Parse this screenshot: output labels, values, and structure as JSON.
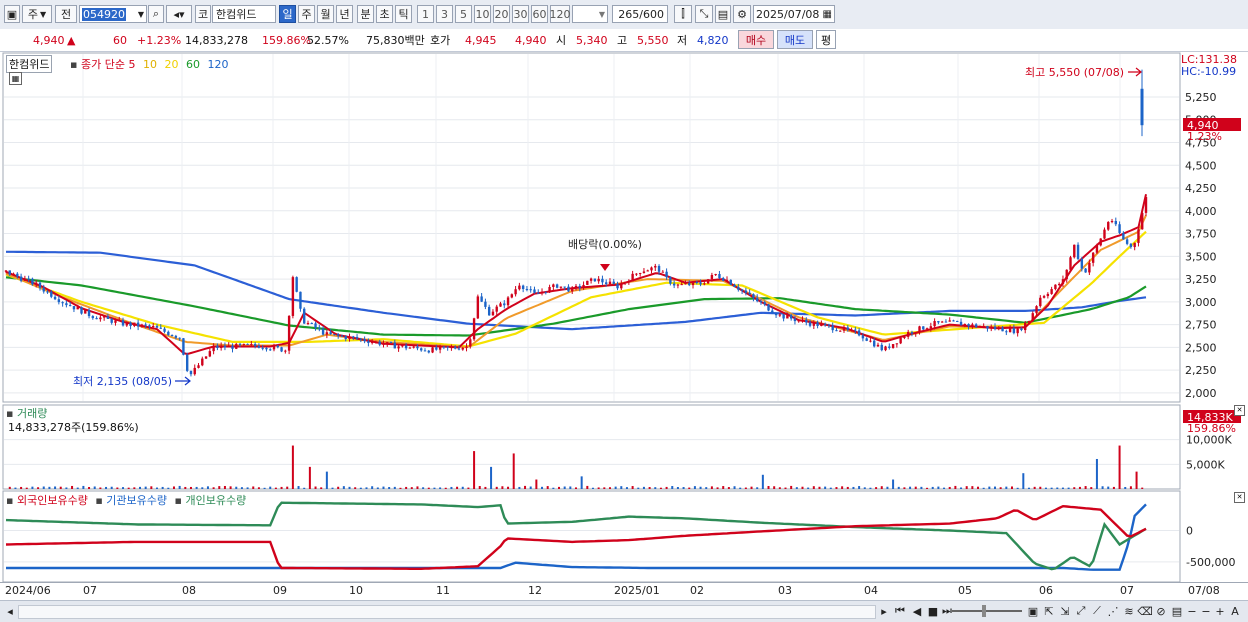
{
  "toolbar": {
    "kind_label": "주",
    "prev_label": "전",
    "code_value": "054920",
    "stock_prefix": "코",
    "stock_name": "한컴위드",
    "periods": [
      "일",
      "주",
      "월",
      "년",
      "분",
      "초",
      "틱"
    ],
    "active_period": "일",
    "intervals": [
      "1",
      "3",
      "5",
      "10",
      "20",
      "30",
      "60",
      "120"
    ],
    "count_value": "265",
    "count_total": "/600",
    "date_value": "2025/07/08"
  },
  "quote": {
    "price": "4,940",
    "change_arrow": "▲",
    "change": "60",
    "change_pct": "+1.23%",
    "volume": "14,833,278",
    "volume_ratio": "159.86%",
    "turnover_rate": "52.57%",
    "amount": "75,830백만",
    "bid_label": "호가",
    "ask_price": "4,945",
    "bid_price": "4,940",
    "open_label": "시",
    "open": "5,340",
    "high_label": "고",
    "high": "5,550",
    "low_label": "저",
    "low": "4,820",
    "buy_label": "매수",
    "sell_label": "매도",
    "avg_label": "평"
  },
  "price_panel": {
    "name_tag": "한컴위드",
    "legend_title": "종가 단순",
    "ma_labels": [
      "5",
      "10",
      "20",
      "60",
      "120"
    ],
    "ma_colors": [
      "#d0021b",
      "#e0b000",
      "#f5d800",
      "#1a9a2a",
      "#1c64c8"
    ],
    "lc_label": "LC:131.38",
    "hc_label": "HC:-10.99",
    "high_annot": "최고 5,550 (07/08)",
    "low_annot": "최저 2,135 (08/05)",
    "dividend_annot": "배당락(0.00%)",
    "current_tag": "4,940",
    "current_pct": "1.23%"
  },
  "volume_panel": {
    "title": "거래량",
    "value_text": "14,833,278주(159.86%)",
    "current_tag": "14,833K",
    "current_pct": "159.86%"
  },
  "holdings_panel": {
    "foreign_label": "외국인보유수량",
    "inst_label": "기관보유수량",
    "indiv_label": "개인보유수량",
    "foreign_color": "#d0021b",
    "inst_color": "#1c64c8",
    "indiv_color": "#2e8b57"
  },
  "x_axis": {
    "labels": [
      "2024/06",
      "07",
      "08",
      "09",
      "10",
      "11",
      "12",
      "2025/01",
      "02",
      "03",
      "04",
      "05",
      "06",
      "07"
    ],
    "end_label": "07/08"
  },
  "chart_data": {
    "type": "candlestick",
    "price_axis": {
      "ticks": [
        2000,
        2250,
        2500,
        2750,
        3000,
        3250,
        3500,
        3750,
        4000,
        4250,
        4500,
        4750,
        5000,
        5250
      ],
      "range": [
        1900,
        5700
      ]
    },
    "volume_axis": {
      "ticks": [
        "5,000K",
        "10,000K"
      ],
      "range": [
        0,
        16000000
      ]
    },
    "holdings_axis": {
      "ticks": [
        "0",
        "-500,000"
      ]
    },
    "price_path": [
      [
        0,
        3330
      ],
      [
        15,
        3200
      ],
      [
        30,
        3000
      ],
      [
        45,
        2850
      ],
      [
        62,
        2760
      ],
      [
        78,
        2720
      ],
      [
        92,
        2610
      ],
      [
        97,
        2180
      ],
      [
        110,
        2500
      ],
      [
        135,
        2520
      ],
      [
        148,
        2470
      ],
      [
        152,
        3280
      ],
      [
        157,
        2800
      ],
      [
        170,
        2640
      ],
      [
        185,
        2600
      ],
      [
        205,
        2520
      ],
      [
        225,
        2470
      ],
      [
        245,
        2510
      ],
      [
        250,
        3050
      ],
      [
        256,
        2880
      ],
      [
        265,
        3000
      ],
      [
        272,
        3200
      ],
      [
        280,
        3080
      ],
      [
        292,
        3180
      ],
      [
        300,
        3130
      ],
      [
        312,
        3250
      ],
      [
        324,
        3170
      ],
      [
        336,
        3340
      ],
      [
        345,
        3380
      ],
      [
        350,
        3250
      ],
      [
        355,
        3180
      ],
      [
        368,
        3200
      ],
      [
        376,
        3300
      ],
      [
        382,
        3240
      ],
      [
        395,
        3050
      ],
      [
        410,
        2850
      ],
      [
        425,
        2770
      ],
      [
        440,
        2710
      ],
      [
        452,
        2650
      ],
      [
        465,
        2470
      ],
      [
        478,
        2660
      ],
      [
        492,
        2760
      ],
      [
        502,
        2770
      ],
      [
        512,
        2740
      ],
      [
        524,
        2710
      ],
      [
        536,
        2680
      ],
      [
        542,
        2800
      ],
      [
        548,
        3050
      ],
      [
        560,
        3230
      ],
      [
        566,
        3620
      ],
      [
        571,
        3300
      ],
      [
        580,
        3700
      ],
      [
        585,
        3930
      ],
      [
        592,
        3680
      ],
      [
        597,
        3580
      ],
      [
        604,
        4140
      ]
    ],
    "ma_paths": {
      "ma5": [
        [
          0,
          3330
        ],
        [
          20,
          3160
        ],
        [
          40,
          2930
        ],
        [
          62,
          2780
        ],
        [
          80,
          2700
        ],
        [
          95,
          2420
        ],
        [
          110,
          2510
        ],
        [
          140,
          2510
        ],
        [
          150,
          2550
        ],
        [
          158,
          2880
        ],
        [
          175,
          2640
        ],
        [
          200,
          2540
        ],
        [
          240,
          2500
        ],
        [
          250,
          2700
        ],
        [
          265,
          2920
        ],
        [
          280,
          3090
        ],
        [
          300,
          3150
        ],
        [
          325,
          3190
        ],
        [
          345,
          3320
        ],
        [
          360,
          3210
        ],
        [
          380,
          3250
        ],
        [
          400,
          3000
        ],
        [
          420,
          2800
        ],
        [
          445,
          2710
        ],
        [
          465,
          2560
        ],
        [
          480,
          2650
        ],
        [
          500,
          2750
        ],
        [
          525,
          2710
        ],
        [
          540,
          2720
        ],
        [
          552,
          2960
        ],
        [
          566,
          3400
        ],
        [
          580,
          3660
        ],
        [
          590,
          3730
        ],
        [
          600,
          3820
        ],
        [
          604,
          4180
        ]
      ],
      "ma10": [
        [
          0,
          3310
        ],
        [
          30,
          3050
        ],
        [
          62,
          2800
        ],
        [
          95,
          2560
        ],
        [
          120,
          2520
        ],
        [
          150,
          2520
        ],
        [
          170,
          2640
        ],
        [
          200,
          2560
        ],
        [
          245,
          2500
        ],
        [
          265,
          2820
        ],
        [
          300,
          3120
        ],
        [
          340,
          3250
        ],
        [
          380,
          3230
        ],
        [
          420,
          2830
        ],
        [
          465,
          2580
        ],
        [
          500,
          2730
        ],
        [
          540,
          2720
        ],
        [
          560,
          3150
        ],
        [
          580,
          3570
        ],
        [
          600,
          3770
        ],
        [
          604,
          3950
        ]
      ],
      "ma20": [
        [
          0,
          3300
        ],
        [
          40,
          3000
        ],
        [
          80,
          2750
        ],
        [
          120,
          2560
        ],
        [
          160,
          2560
        ],
        [
          200,
          2590
        ],
        [
          245,
          2510
        ],
        [
          270,
          2650
        ],
        [
          310,
          3050
        ],
        [
          350,
          3210
        ],
        [
          390,
          3180
        ],
        [
          430,
          2830
        ],
        [
          465,
          2640
        ],
        [
          510,
          2710
        ],
        [
          550,
          2770
        ],
        [
          575,
          3200
        ],
        [
          590,
          3500
        ],
        [
          604,
          3770
        ]
      ],
      "ma60": [
        [
          0,
          3270
        ],
        [
          40,
          3180
        ],
        [
          100,
          2950
        ],
        [
          150,
          2740
        ],
        [
          200,
          2640
        ],
        [
          245,
          2630
        ],
        [
          290,
          2760
        ],
        [
          330,
          2920
        ],
        [
          370,
          3030
        ],
        [
          410,
          3040
        ],
        [
          450,
          2920
        ],
        [
          500,
          2860
        ],
        [
          540,
          2770
        ],
        [
          575,
          2920
        ],
        [
          595,
          3050
        ],
        [
          604,
          3170
        ]
      ],
      "ma120": [
        [
          0,
          3550
        ],
        [
          50,
          3540
        ],
        [
          100,
          3400
        ],
        [
          150,
          3030
        ],
        [
          200,
          2880
        ],
        [
          245,
          2760
        ],
        [
          300,
          2700
        ],
        [
          360,
          2780
        ],
        [
          400,
          2880
        ],
        [
          450,
          2850
        ],
        [
          500,
          2900
        ],
        [
          540,
          2900
        ],
        [
          570,
          2940
        ],
        [
          590,
          3010
        ],
        [
          604,
          3050
        ]
      ]
    },
    "holdings_series": {
      "indiv": [
        [
          0,
          0.3
        ],
        [
          70,
          0.35
        ],
        [
          140,
          0.36
        ],
        [
          145,
          0.1
        ],
        [
          220,
          0.12
        ],
        [
          250,
          0.15
        ],
        [
          262,
          0.13
        ],
        [
          265,
          0.34
        ],
        [
          300,
          0.32
        ],
        [
          310,
          0.3
        ],
        [
          330,
          0.26
        ],
        [
          360,
          0.28
        ],
        [
          400,
          0.33
        ],
        [
          450,
          0.38
        ],
        [
          500,
          0.42
        ],
        [
          530,
          0.45
        ],
        [
          545,
          0.8
        ],
        [
          555,
          0.87
        ],
        [
          565,
          0.72
        ],
        [
          575,
          0.84
        ],
        [
          582,
          0.35
        ],
        [
          590,
          0.58
        ],
        [
          604,
          0.4
        ]
      ],
      "foreign": [
        [
          0,
          0.58
        ],
        [
          70,
          0.55
        ],
        [
          140,
          0.55
        ],
        [
          145,
          0.85
        ],
        [
          220,
          0.86
        ],
        [
          250,
          0.83
        ],
        [
          262,
          0.6
        ],
        [
          265,
          0.51
        ],
        [
          300,
          0.55
        ],
        [
          330,
          0.53
        ],
        [
          360,
          0.48
        ],
        [
          400,
          0.43
        ],
        [
          450,
          0.37
        ],
        [
          500,
          0.34
        ],
        [
          525,
          0.28
        ],
        [
          535,
          0.18
        ],
        [
          545,
          0.3
        ],
        [
          560,
          0.14
        ],
        [
          580,
          0.18
        ],
        [
          595,
          0.5
        ],
        [
          604,
          0.4
        ]
      ],
      "inst": [
        [
          0,
          0.85
        ],
        [
          250,
          0.85
        ],
        [
          262,
          0.85
        ],
        [
          270,
          0.79
        ],
        [
          300,
          0.84
        ],
        [
          340,
          0.85
        ],
        [
          400,
          0.85
        ],
        [
          500,
          0.85
        ],
        [
          560,
          0.85
        ],
        [
          575,
          0.87
        ],
        [
          590,
          0.87
        ],
        [
          595,
          0.55
        ],
        [
          598,
          0.25
        ],
        [
          604,
          0.12
        ]
      ]
    }
  }
}
